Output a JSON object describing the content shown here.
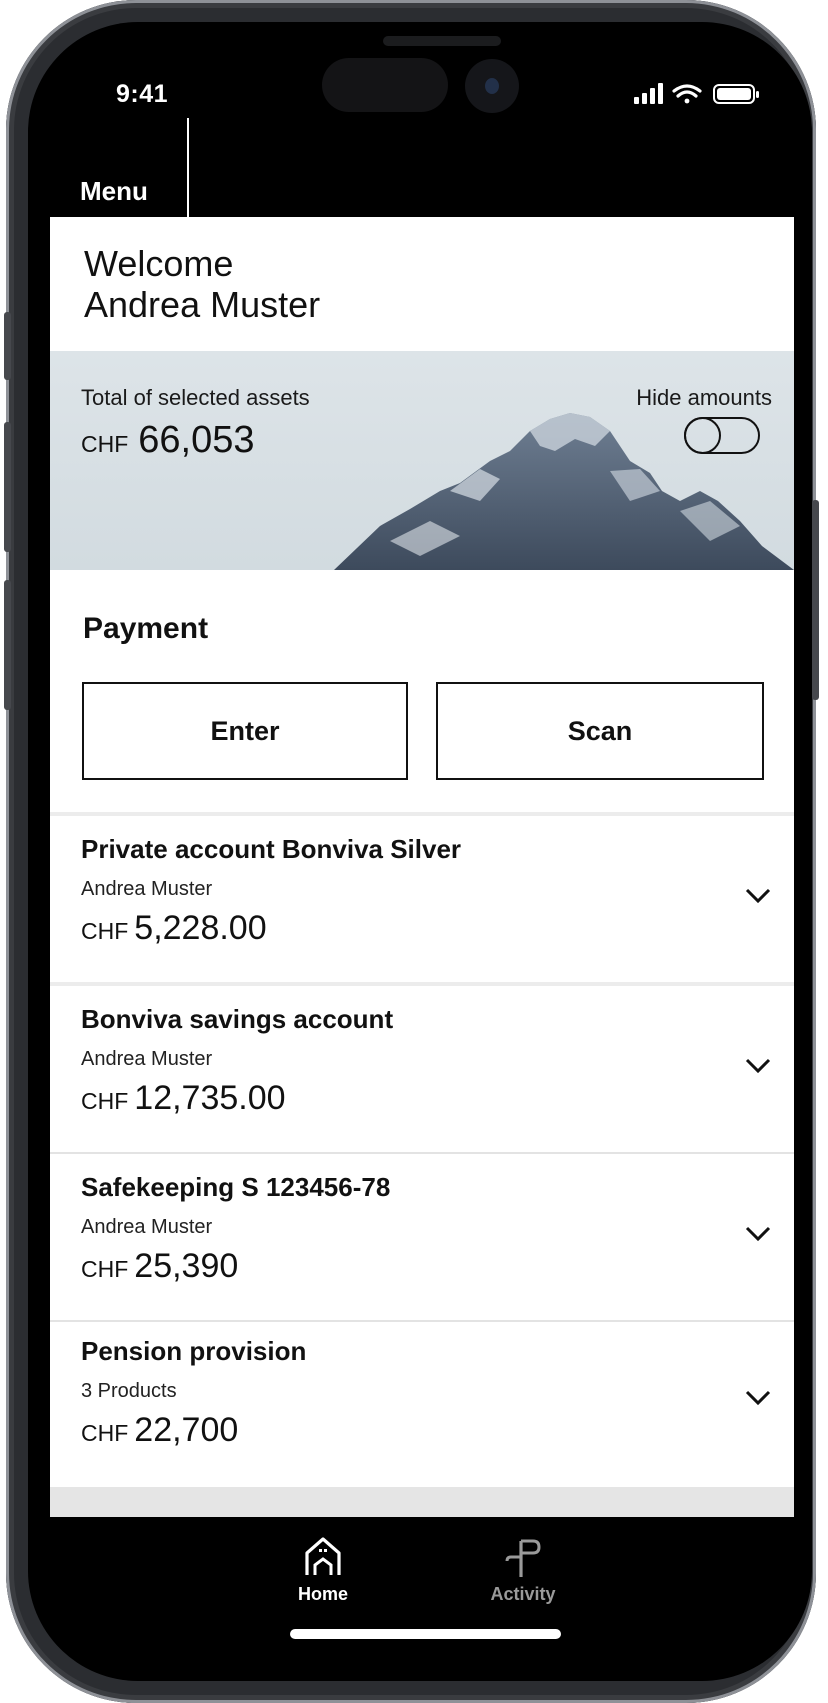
{
  "status_bar": {
    "time": "9:41"
  },
  "menu": {
    "label": "Menu"
  },
  "welcome": {
    "line1": "Welcome",
    "line2": "Andrea Muster"
  },
  "assets": {
    "label": "Total of selected assets",
    "currency": "CHF",
    "total": "66,053",
    "hide_label": "Hide amounts",
    "hide_enabled": false
  },
  "payment": {
    "title": "Payment",
    "enter_label": "Enter",
    "scan_label": "Scan"
  },
  "accounts": [
    {
      "title": "Private account Bonviva Silver",
      "subtitle": "Andrea Muster",
      "currency": "CHF",
      "amount": "5,228.00"
    },
    {
      "title": "Bonviva savings account",
      "subtitle": "Andrea Muster",
      "currency": "CHF",
      "amount": "12,735.00"
    },
    {
      "title": "Safekeeping S 123456-78",
      "subtitle": "Andrea Muster",
      "currency": "CHF",
      "amount": "25,390"
    },
    {
      "title": "Pension provision",
      "subtitle": "3 Products",
      "currency": "CHF",
      "amount": "22,700"
    }
  ],
  "tabbar": {
    "home_label": "Home",
    "activity_label": "Activity",
    "active": "Home"
  },
  "colors": {
    "frame": "#2b2d31",
    "background": "#000000",
    "surface": "#ffffff",
    "hero": "#d8e0e4",
    "text": "#111111",
    "tab_inactive": "#9a9a9a"
  }
}
